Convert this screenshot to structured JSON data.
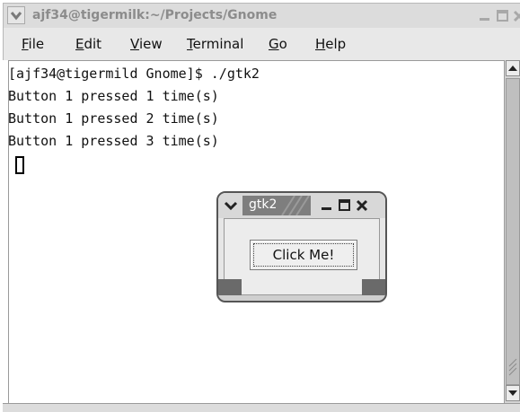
{
  "terminal": {
    "title": "ajf34@tigermilk:~/Projects/Gnome",
    "menu": [
      {
        "label": "File",
        "mnemonic": "F",
        "rest": "ile"
      },
      {
        "label": "Edit",
        "mnemonic": "E",
        "rest": "dit"
      },
      {
        "label": "View",
        "mnemonic": "V",
        "rest": "iew"
      },
      {
        "label": "Terminal",
        "mnemonic": "T",
        "rest": "erminal"
      },
      {
        "label": "Go",
        "mnemonic": "G",
        "rest": "o"
      },
      {
        "label": "Help",
        "mnemonic": "H",
        "rest": "elp"
      }
    ],
    "lines": [
      "[ajf34@tigermild Gnome]$ ./gtk2",
      "Button 1 pressed 1 time(s)",
      "Button 1 pressed 2 time(s)",
      "Button 1 pressed 3 time(s)"
    ]
  },
  "gtk_window": {
    "title": "gtk2",
    "button_label": "Click Me!"
  },
  "icons": {
    "window_menu": "chevron-down-icon",
    "minimize": "minimize-icon",
    "maximize": "maximize-icon",
    "close": "close-icon",
    "scroll_up": "arrow-up-icon",
    "scroll_down": "arrow-down-icon",
    "resize_grip": "resize-grip-icon"
  },
  "colors": {
    "titlebar_text": "#8c8c8c",
    "window_bg": "#dcdcdc",
    "terminal_bg": "#ffffff",
    "active_title_bg": "#7e7e7e"
  }
}
